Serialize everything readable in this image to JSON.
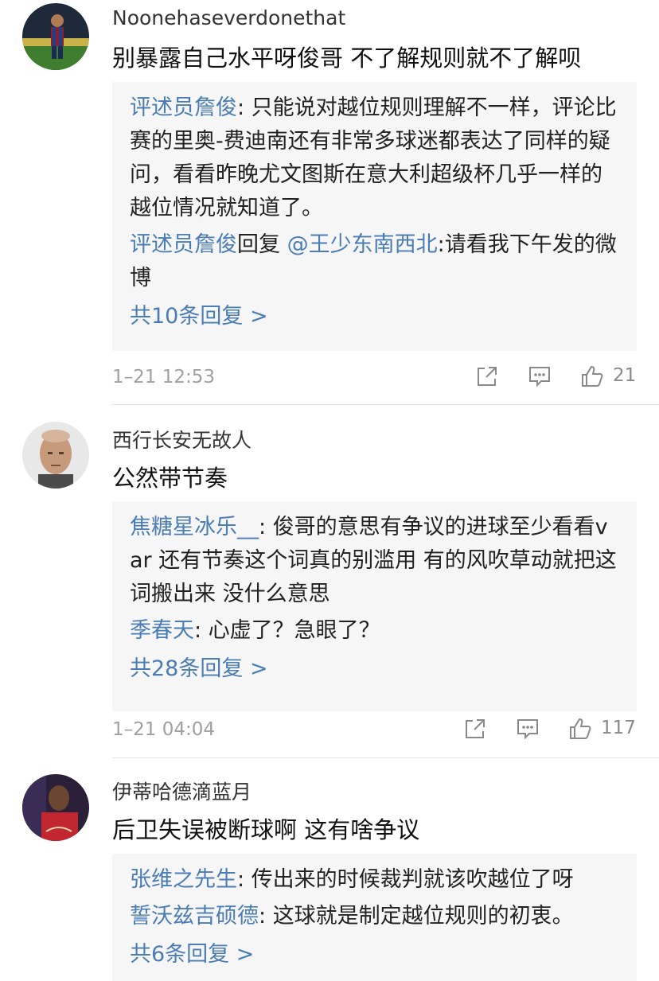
{
  "comments": [
    {
      "username": "Noonehaseverdonethat",
      "content": "别暴露自己水平呀俊哥 不了解规则就不了解呗",
      "replies": [
        {
          "name": "评述员詹俊",
          "sep": ": ",
          "mention": "",
          "text": "只能说对越位规则理解不一样，评论比赛的里奥-费迪南还有非常多球迷都表达了同样的疑问，看看昨晚尤文图斯在意大利超级杯几乎一样的越位情况就知道了。"
        },
        {
          "name": "评述员詹俊",
          "sep": "回复 ",
          "mention": "@王少东南西北",
          "text": ":请看我下午发的微博"
        }
      ],
      "more": "共10条回复 >",
      "time": "1–21 12:53",
      "likes": "21"
    },
    {
      "username": "西行长安无故人",
      "content": "公然带节奏",
      "replies": [
        {
          "name": "焦糖星冰乐__",
          "sep": ": ",
          "mention": "",
          "text": "俊哥的意思有争议的进球至少看看var 还有节奏这个词真的别滥用 有的风吹草动就把这词搬出来 没什么意思"
        },
        {
          "name": "季春天",
          "sep": ": ",
          "mention": "",
          "text": "心虚了？急眼了？"
        }
      ],
      "more": "共28条回复 >",
      "time": "1–21 04:04",
      "likes": "117"
    },
    {
      "username": "伊蒂哈德滴蓝月",
      "content": "后卫失误被断球啊  这有啥争议",
      "replies": [
        {
          "name": "张维之先生",
          "sep": ": ",
          "mention": "",
          "text": "传出来的时候裁判就该吹越位了呀"
        },
        {
          "name": "誓沃兹吉硕德",
          "sep": ": ",
          "mention": "",
          "text": "这球就是制定越位规则的初衷。"
        }
      ],
      "more": "共6条回复 >",
      "time": "",
      "likes": ""
    }
  ],
  "icons": {
    "share": "share-icon",
    "comment": "comment-icon",
    "like": "thumbs-up-icon"
  },
  "colors": {
    "link": "#4a7db5",
    "reply_bg": "#f6f6f6",
    "meta": "#a0a0a0"
  }
}
